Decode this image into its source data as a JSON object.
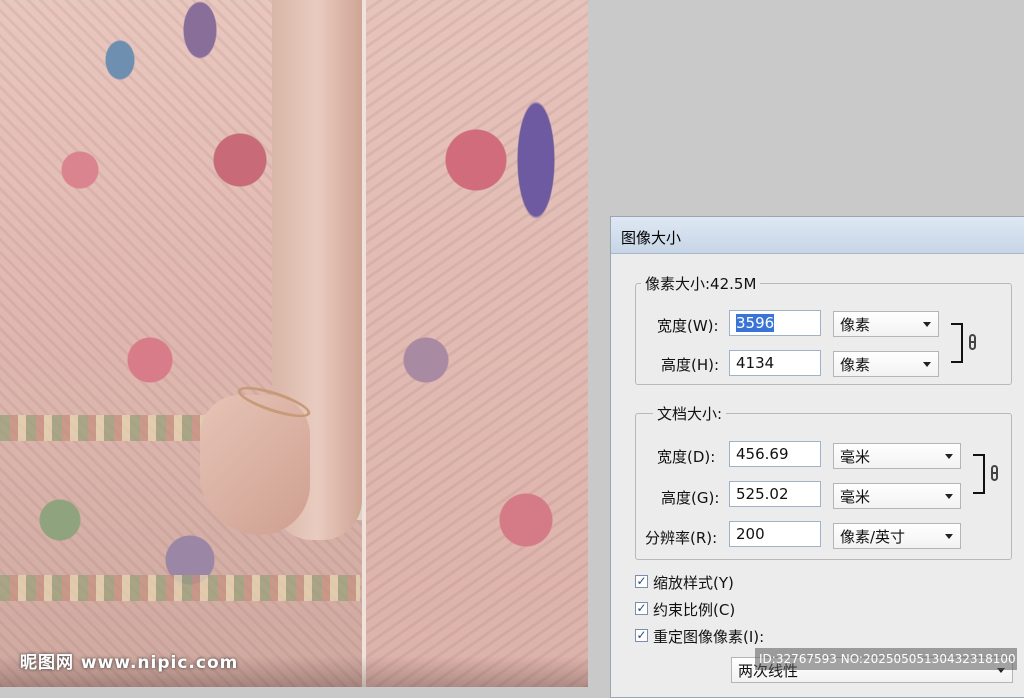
{
  "dialog": {
    "title": "图像大小"
  },
  "pixel_dimensions": {
    "legend": "像素大小:42.5M",
    "width_label": "宽度(W):",
    "width_value": "3596",
    "width_unit": "像素",
    "height_label": "高度(H):",
    "height_value": "4134",
    "height_unit": "像素"
  },
  "document_size": {
    "legend": "文档大小:",
    "width_label": "宽度(D):",
    "width_value": "456.69",
    "width_unit": "毫米",
    "height_label": "高度(G):",
    "height_value": "525.02",
    "height_unit": "毫米",
    "resolution_label": "分辨率(R):",
    "resolution_value": "200",
    "resolution_unit": "像素/英寸"
  },
  "options": {
    "scale_styles": {
      "label": "缩放样式(Y)",
      "checked": true
    },
    "constrain_proportions": {
      "label": "约束比例(C)",
      "checked": true
    },
    "resample": {
      "label": "重定图像像素(I):",
      "checked": true
    },
    "resample_method": "两次线性"
  },
  "watermarks": {
    "left": "昵图网 www.nipic.com",
    "right": "ID:32767593 NO:20250505130432318100"
  },
  "icons": {
    "link_chain": "chain-link-icon",
    "dropdown": "chevron-down-icon",
    "checkbox": "checkmark-icon"
  }
}
